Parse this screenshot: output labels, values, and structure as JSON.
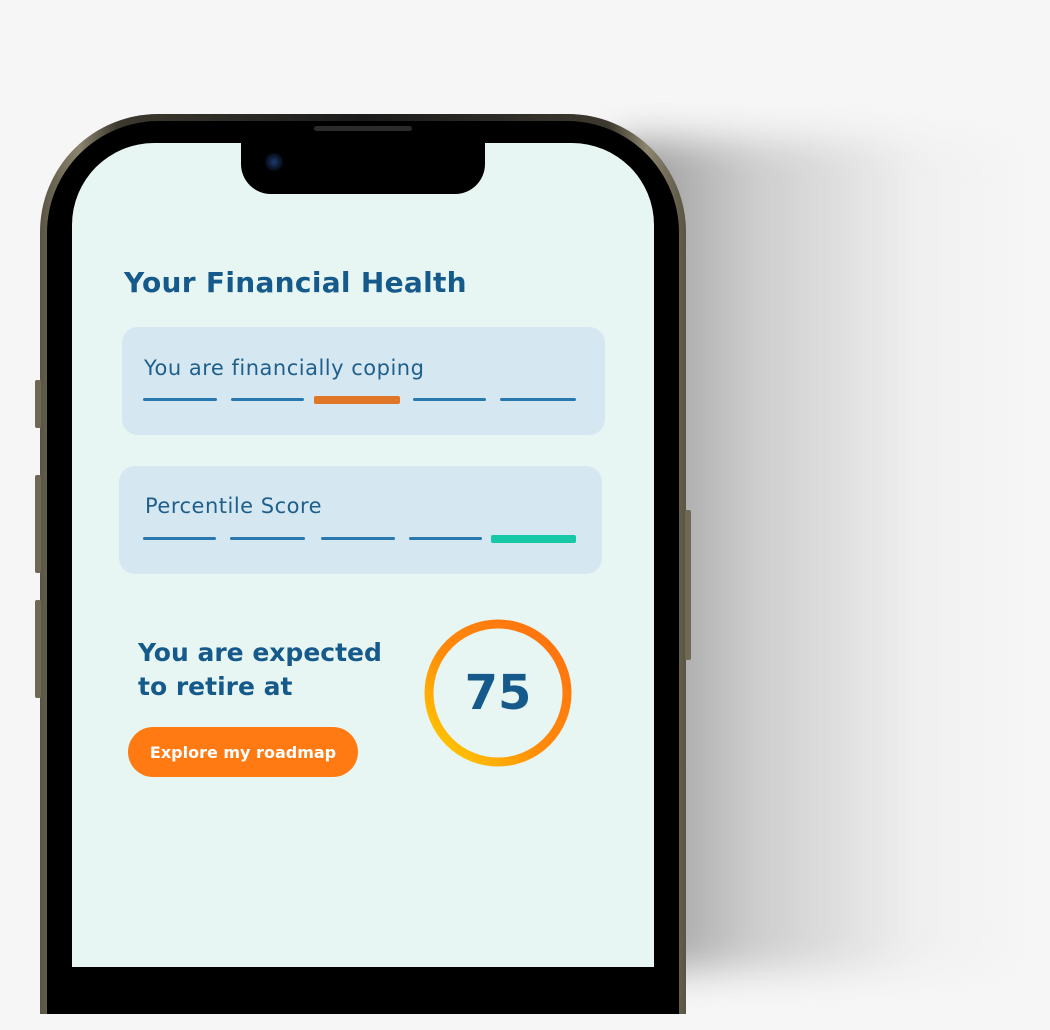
{
  "page": {
    "title": "Your Financial Health"
  },
  "status_card": {
    "label": "You are financially coping",
    "segment_count": 5,
    "active_segment": 3,
    "accent_color": "#e07628"
  },
  "percentile_card": {
    "label": "Percentile Score",
    "segment_count": 5,
    "active_segment": 5,
    "accent_color": "#17c8a6"
  },
  "retirement": {
    "line1": "You are expected",
    "line2": "to retire at",
    "age": "75",
    "ring_colors": [
      "#ff7a12",
      "#ffd000"
    ]
  },
  "cta": {
    "label": "Explore my roadmap",
    "color": "#ff7a12"
  },
  "colors": {
    "primary_text": "#155a8a",
    "screen_bg": "#e7f6f2",
    "card_bg": "#d5e7f1",
    "segment": "#2a78b0"
  },
  "icons": {
    "camera": "front-camera-icon"
  }
}
